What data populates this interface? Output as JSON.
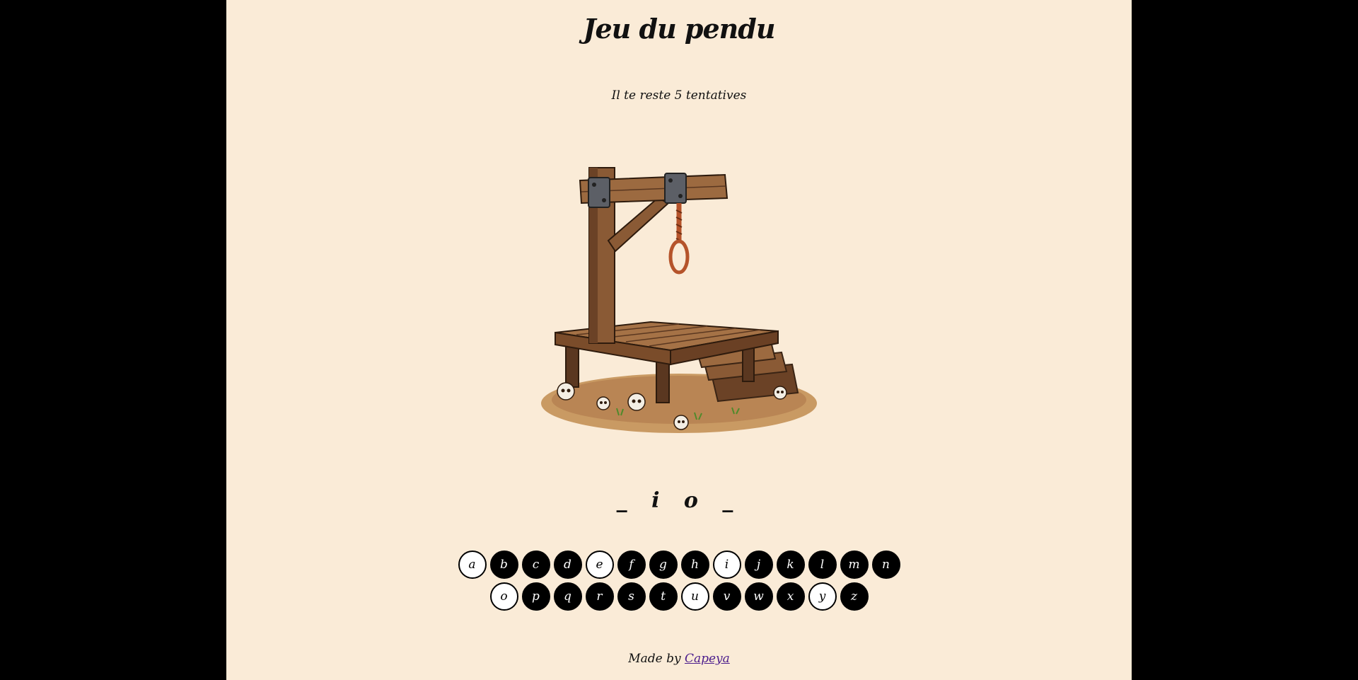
{
  "title": "Jeu du pendu",
  "attempts_text": "Il te reste 5 tentatives",
  "word_display": "_ i o _",
  "keyboard": {
    "row1": [
      {
        "letter": "a",
        "used": true
      },
      {
        "letter": "b",
        "used": false
      },
      {
        "letter": "c",
        "used": false
      },
      {
        "letter": "d",
        "used": false
      },
      {
        "letter": "e",
        "used": true
      },
      {
        "letter": "f",
        "used": false
      },
      {
        "letter": "g",
        "used": false
      },
      {
        "letter": "h",
        "used": false
      },
      {
        "letter": "i",
        "used": true
      },
      {
        "letter": "j",
        "used": false
      },
      {
        "letter": "k",
        "used": false
      },
      {
        "letter": "l",
        "used": false
      },
      {
        "letter": "m",
        "used": false
      },
      {
        "letter": "n",
        "used": false
      }
    ],
    "row2": [
      {
        "letter": "o",
        "used": true
      },
      {
        "letter": "p",
        "used": false
      },
      {
        "letter": "q",
        "used": false
      },
      {
        "letter": "r",
        "used": false
      },
      {
        "letter": "s",
        "used": false
      },
      {
        "letter": "t",
        "used": false
      },
      {
        "letter": "u",
        "used": true
      },
      {
        "letter": "v",
        "used": false
      },
      {
        "letter": "w",
        "used": false
      },
      {
        "letter": "x",
        "used": false
      },
      {
        "letter": "y",
        "used": true
      },
      {
        "letter": "z",
        "used": false
      }
    ]
  },
  "footer": {
    "prefix": "Made by",
    "link_text": "Capeya"
  },
  "colors": {
    "page_background": "#faebd7",
    "outer_background": "#000000",
    "key_available": "#000000",
    "key_used": "#ffffff",
    "link": "#4b1c8c"
  },
  "image": {
    "icon": "gallows-illustration"
  }
}
